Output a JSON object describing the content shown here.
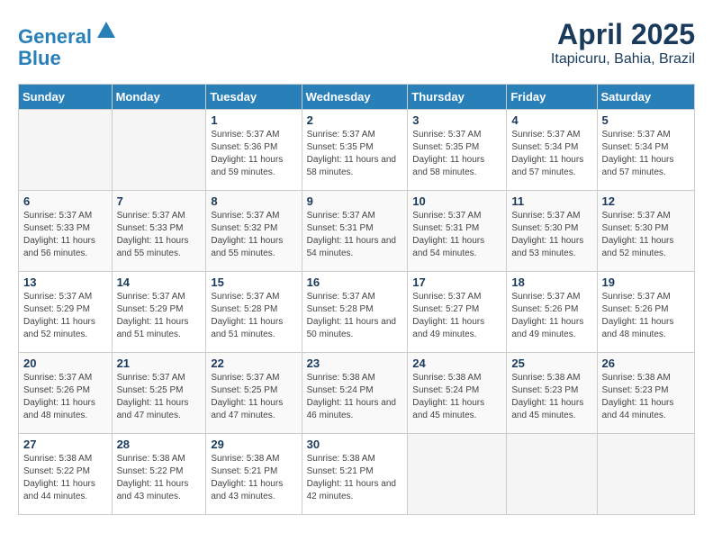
{
  "header": {
    "logo_line1": "General",
    "logo_line2": "Blue",
    "title": "April 2025",
    "subtitle": "Itapicuru, Bahia, Brazil"
  },
  "days_of_week": [
    "Sunday",
    "Monday",
    "Tuesday",
    "Wednesday",
    "Thursday",
    "Friday",
    "Saturday"
  ],
  "weeks": [
    [
      {
        "day": "",
        "info": ""
      },
      {
        "day": "",
        "info": ""
      },
      {
        "day": "1",
        "info": "Sunrise: 5:37 AM\nSunset: 5:36 PM\nDaylight: 11 hours and 59 minutes."
      },
      {
        "day": "2",
        "info": "Sunrise: 5:37 AM\nSunset: 5:35 PM\nDaylight: 11 hours and 58 minutes."
      },
      {
        "day": "3",
        "info": "Sunrise: 5:37 AM\nSunset: 5:35 PM\nDaylight: 11 hours and 58 minutes."
      },
      {
        "day": "4",
        "info": "Sunrise: 5:37 AM\nSunset: 5:34 PM\nDaylight: 11 hours and 57 minutes."
      },
      {
        "day": "5",
        "info": "Sunrise: 5:37 AM\nSunset: 5:34 PM\nDaylight: 11 hours and 57 minutes."
      }
    ],
    [
      {
        "day": "6",
        "info": "Sunrise: 5:37 AM\nSunset: 5:33 PM\nDaylight: 11 hours and 56 minutes."
      },
      {
        "day": "7",
        "info": "Sunrise: 5:37 AM\nSunset: 5:33 PM\nDaylight: 11 hours and 55 minutes."
      },
      {
        "day": "8",
        "info": "Sunrise: 5:37 AM\nSunset: 5:32 PM\nDaylight: 11 hours and 55 minutes."
      },
      {
        "day": "9",
        "info": "Sunrise: 5:37 AM\nSunset: 5:31 PM\nDaylight: 11 hours and 54 minutes."
      },
      {
        "day": "10",
        "info": "Sunrise: 5:37 AM\nSunset: 5:31 PM\nDaylight: 11 hours and 54 minutes."
      },
      {
        "day": "11",
        "info": "Sunrise: 5:37 AM\nSunset: 5:30 PM\nDaylight: 11 hours and 53 minutes."
      },
      {
        "day": "12",
        "info": "Sunrise: 5:37 AM\nSunset: 5:30 PM\nDaylight: 11 hours and 52 minutes."
      }
    ],
    [
      {
        "day": "13",
        "info": "Sunrise: 5:37 AM\nSunset: 5:29 PM\nDaylight: 11 hours and 52 minutes."
      },
      {
        "day": "14",
        "info": "Sunrise: 5:37 AM\nSunset: 5:29 PM\nDaylight: 11 hours and 51 minutes."
      },
      {
        "day": "15",
        "info": "Sunrise: 5:37 AM\nSunset: 5:28 PM\nDaylight: 11 hours and 51 minutes."
      },
      {
        "day": "16",
        "info": "Sunrise: 5:37 AM\nSunset: 5:28 PM\nDaylight: 11 hours and 50 minutes."
      },
      {
        "day": "17",
        "info": "Sunrise: 5:37 AM\nSunset: 5:27 PM\nDaylight: 11 hours and 49 minutes."
      },
      {
        "day": "18",
        "info": "Sunrise: 5:37 AM\nSunset: 5:26 PM\nDaylight: 11 hours and 49 minutes."
      },
      {
        "day": "19",
        "info": "Sunrise: 5:37 AM\nSunset: 5:26 PM\nDaylight: 11 hours and 48 minutes."
      }
    ],
    [
      {
        "day": "20",
        "info": "Sunrise: 5:37 AM\nSunset: 5:26 PM\nDaylight: 11 hours and 48 minutes."
      },
      {
        "day": "21",
        "info": "Sunrise: 5:37 AM\nSunset: 5:25 PM\nDaylight: 11 hours and 47 minutes."
      },
      {
        "day": "22",
        "info": "Sunrise: 5:37 AM\nSunset: 5:25 PM\nDaylight: 11 hours and 47 minutes."
      },
      {
        "day": "23",
        "info": "Sunrise: 5:38 AM\nSunset: 5:24 PM\nDaylight: 11 hours and 46 minutes."
      },
      {
        "day": "24",
        "info": "Sunrise: 5:38 AM\nSunset: 5:24 PM\nDaylight: 11 hours and 45 minutes."
      },
      {
        "day": "25",
        "info": "Sunrise: 5:38 AM\nSunset: 5:23 PM\nDaylight: 11 hours and 45 minutes."
      },
      {
        "day": "26",
        "info": "Sunrise: 5:38 AM\nSunset: 5:23 PM\nDaylight: 11 hours and 44 minutes."
      }
    ],
    [
      {
        "day": "27",
        "info": "Sunrise: 5:38 AM\nSunset: 5:22 PM\nDaylight: 11 hours and 44 minutes."
      },
      {
        "day": "28",
        "info": "Sunrise: 5:38 AM\nSunset: 5:22 PM\nDaylight: 11 hours and 43 minutes."
      },
      {
        "day": "29",
        "info": "Sunrise: 5:38 AM\nSunset: 5:21 PM\nDaylight: 11 hours and 43 minutes."
      },
      {
        "day": "30",
        "info": "Sunrise: 5:38 AM\nSunset: 5:21 PM\nDaylight: 11 hours and 42 minutes."
      },
      {
        "day": "",
        "info": ""
      },
      {
        "day": "",
        "info": ""
      },
      {
        "day": "",
        "info": ""
      }
    ]
  ]
}
